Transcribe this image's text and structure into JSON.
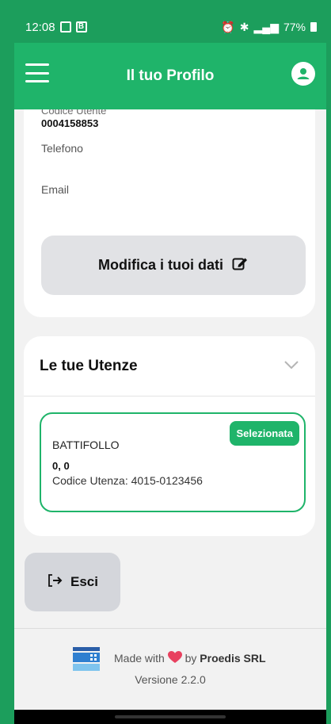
{
  "status_bar": {
    "time": "12:08",
    "battery": "77%"
  },
  "app_bar": {
    "title": "Il tuo Profilo"
  },
  "profile": {
    "codice_label": "Codice Utente",
    "codice_value": "0004158853",
    "telefono_label": "Telefono",
    "email_label": "Email",
    "edit_button_label": "Modifica i tuoi dati"
  },
  "utenze": {
    "title": "Le tue Utenze",
    "items": [
      {
        "badge": "Selezionata",
        "name": "BATTIFOLLO",
        "value": "0, 0",
        "code": "Codice Utenza: 4015-0123456"
      }
    ]
  },
  "logout": {
    "label": "Esci"
  },
  "footer": {
    "made_with": "Made with",
    "by": "by",
    "company": "Proedis SRL",
    "version": "Versione 2.2.0"
  },
  "colors": {
    "primary": "#1fb46a",
    "status_bar": "#1c9e5c",
    "heart": "#e8415f"
  }
}
